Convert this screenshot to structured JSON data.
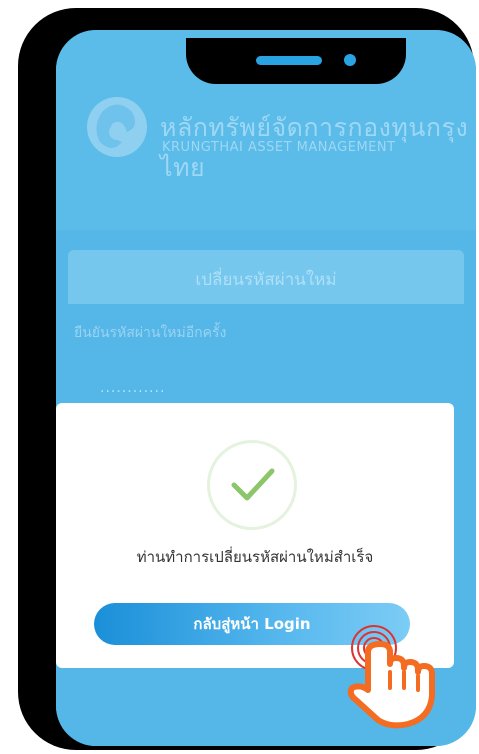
{
  "header": {
    "brand_thai": "หลักทรัพย์จัดการกองทุนกรุงไทย",
    "brand_english": "KRUNGTHAI ASSET MANAGEMENT"
  },
  "form": {
    "card_title": "เปลี่ยนรหัสผ่านใหม่",
    "confirm_label": "ยืนยันรหัสผ่านใหม่อีกครั้ง",
    "confirm_value": "............"
  },
  "dialog": {
    "message": "ท่านทำการเปลี่ยนรหัสผ่านใหม่สำเร็จ",
    "button_label": "กลับสู่หน้า Login",
    "icon": "check-icon"
  },
  "colors": {
    "accent": "#1a8fd8",
    "check": "#8cc56a",
    "hand": "#f36c21"
  }
}
